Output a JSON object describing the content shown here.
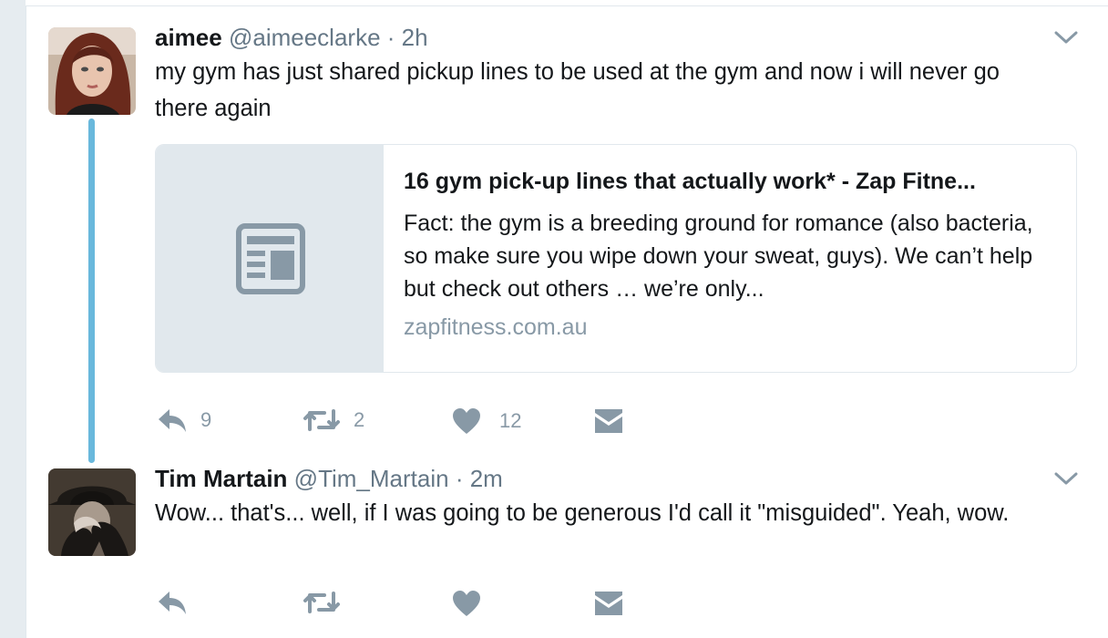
{
  "tweets": [
    {
      "name": "aimee",
      "handle": "@aimeeclarke",
      "time": "· 2h",
      "text": "my gym has just shared pickup lines to be used at the gym and now i will never go there again",
      "card": {
        "title": "16 gym pick-up lines that actually work* - Zap Fitne...",
        "description": "Fact: the gym is a breeding ground for romance (also bacteria, so make sure you wipe down your sweat, guys). We can’t help but check out others … we’re only...",
        "domain": "zapfitness.com.au"
      },
      "actions": {
        "replies": "9",
        "retweets": "2",
        "likes": "12"
      }
    },
    {
      "name": "Tim Martain",
      "handle": "@Tim_Martain",
      "time": "· 2m",
      "text": "Wow... that's... well, if I was going to be generous I'd call it \"misguided\". Yeah, wow."
    }
  ],
  "icons": {
    "reply": "reply-icon",
    "retweet": "retweet-icon",
    "like": "heart-icon",
    "dm": "envelope-icon",
    "caret": "chevron-down-icon",
    "card": "article-icon"
  },
  "colors": {
    "thread_line": "#69b8dc",
    "muted": "#657786",
    "icon": "#8899a6"
  }
}
